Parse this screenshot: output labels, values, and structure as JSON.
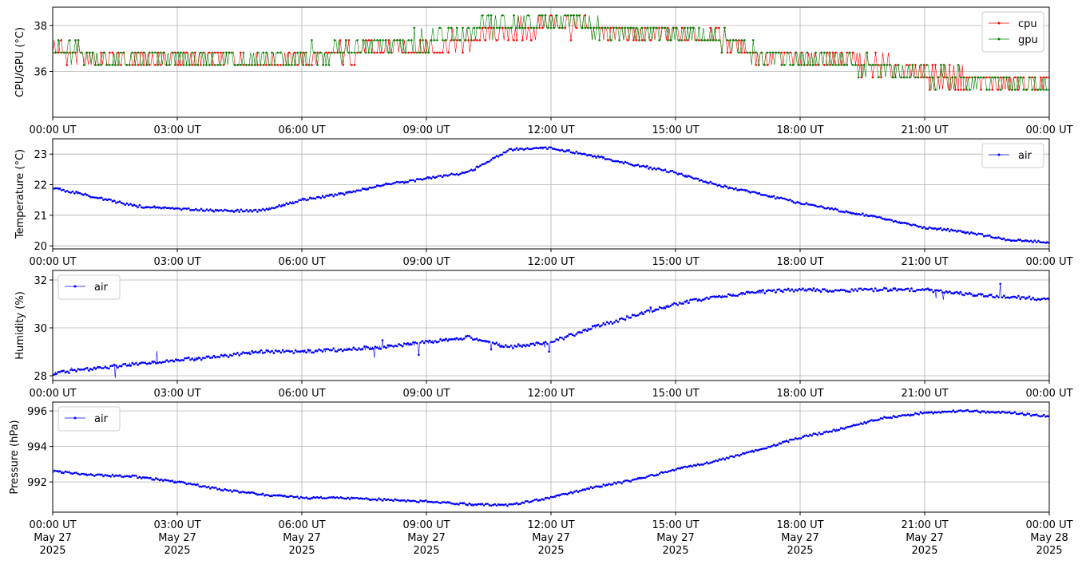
{
  "chart_data": [
    {
      "type": "line",
      "ylabel": "CPU/GPU (°C)",
      "ylim": [
        34.0,
        38.8
      ],
      "yticks": [
        36,
        38
      ],
      "ytick_labels": [
        "36",
        "38"
      ],
      "grid": true,
      "legend_position": "top-right",
      "x": [
        "00:00",
        "01:00",
        "02:00",
        "03:00",
        "04:00",
        "05:00",
        "06:00",
        "07:00",
        "08:00",
        "09:00",
        "10:00",
        "11:00",
        "12:00",
        "13:00",
        "14:00",
        "15:00",
        "16:00",
        "17:00",
        "18:00",
        "19:00",
        "20:00",
        "21:00",
        "22:00",
        "23:00",
        "24:00"
      ],
      "series": [
        {
          "name": "cpu",
          "color": "#ff0000",
          "values": [
            36.9,
            36.4,
            36.4,
            36.4,
            36.4,
            36.4,
            36.4,
            36.7,
            36.9,
            36.9,
            37.2,
            37.6,
            38.0,
            37.8,
            37.5,
            37.5,
            37.4,
            36.6,
            36.5,
            36.4,
            36.1,
            35.7,
            35.6,
            35.4,
            35.3
          ]
        },
        {
          "name": "gpu",
          "color": "#008000",
          "values": [
            36.9,
            36.5,
            36.4,
            36.4,
            36.4,
            36.4,
            36.5,
            36.8,
            37.0,
            37.2,
            37.5,
            38.0,
            38.1,
            37.9,
            37.6,
            37.5,
            37.4,
            36.6,
            36.5,
            36.4,
            36.0,
            35.6,
            35.5,
            35.4,
            35.3
          ]
        }
      ]
    },
    {
      "type": "line",
      "ylabel": "Temperature (°C)",
      "ylim": [
        19.9,
        23.5
      ],
      "yticks": [
        20,
        21,
        22,
        23
      ],
      "ytick_labels": [
        "20",
        "21",
        "22",
        "23"
      ],
      "grid": true,
      "legend_position": "top-right",
      "x": [
        "00:00",
        "01:00",
        "02:00",
        "03:00",
        "04:00",
        "05:00",
        "06:00",
        "07:00",
        "08:00",
        "09:00",
        "10:00",
        "11:00",
        "12:00",
        "13:00",
        "14:00",
        "15:00",
        "16:00",
        "17:00",
        "18:00",
        "19:00",
        "20:00",
        "21:00",
        "22:00",
        "23:00",
        "24:00"
      ],
      "series": [
        {
          "name": "air",
          "color": "#0000ff",
          "values": [
            21.9,
            21.6,
            21.3,
            21.2,
            21.15,
            21.15,
            21.5,
            21.7,
            22.0,
            22.2,
            22.4,
            23.15,
            23.2,
            22.95,
            22.65,
            22.4,
            22.0,
            21.7,
            21.4,
            21.15,
            20.9,
            20.6,
            20.45,
            20.2,
            20.1
          ]
        }
      ]
    },
    {
      "type": "line",
      "ylabel": "Humidity (%)",
      "ylim": [
        27.8,
        32.4
      ],
      "yticks": [
        28,
        30,
        32
      ],
      "ytick_labels": [
        "28",
        "30",
        "32"
      ],
      "grid": true,
      "legend_position": "top-left",
      "x": [
        "00:00",
        "01:00",
        "02:00",
        "03:00",
        "04:00",
        "05:00",
        "06:00",
        "07:00",
        "08:00",
        "09:00",
        "10:00",
        "11:00",
        "12:00",
        "13:00",
        "14:00",
        "15:00",
        "16:00",
        "17:00",
        "18:00",
        "19:00",
        "20:00",
        "21:00",
        "22:00",
        "23:00",
        "24:00"
      ],
      "series": [
        {
          "name": "air",
          "color": "#0000ff",
          "values": [
            28.1,
            28.3,
            28.5,
            28.65,
            28.8,
            29.0,
            29.0,
            29.1,
            29.2,
            29.4,
            29.6,
            29.2,
            29.4,
            30.0,
            30.5,
            31.0,
            31.3,
            31.5,
            31.6,
            31.55,
            31.6,
            31.6,
            31.4,
            31.3,
            31.2
          ]
        }
      ]
    },
    {
      "type": "line",
      "ylabel": "Pressure (hPa)",
      "ylim": [
        990.3,
        996.5
      ],
      "yticks": [
        992,
        994,
        996
      ],
      "ytick_labels": [
        "992",
        "994",
        "996"
      ],
      "grid": true,
      "legend_position": "top-left",
      "x": [
        "00:00",
        "01:00",
        "02:00",
        "03:00",
        "04:00",
        "05:00",
        "06:00",
        "07:00",
        "08:00",
        "09:00",
        "10:00",
        "11:00",
        "12:00",
        "13:00",
        "14:00",
        "15:00",
        "16:00",
        "17:00",
        "18:00",
        "19:00",
        "20:00",
        "21:00",
        "22:00",
        "23:00",
        "24:00"
      ],
      "xtick_labels": [
        "00:00 UT\nMay 27\n2025",
        "03:00 UT\nMay 27\n2025",
        "06:00 UT\nMay 27\n2025",
        "09:00 UT\nMay 27\n2025",
        "12:00 UT\nMay 27\n2025",
        "15:00 UT\nMay 27\n2025",
        "18:00 UT\nMay 27\n2025",
        "21:00 UT\nMay 27\n2025",
        "00:00 UT\nMay 28\n2025"
      ],
      "series": [
        {
          "name": "air",
          "color": "#0000ff",
          "values": [
            992.6,
            992.4,
            992.3,
            992.0,
            991.6,
            991.3,
            991.1,
            991.1,
            991.0,
            990.9,
            990.75,
            990.7,
            991.1,
            991.7,
            992.1,
            992.7,
            993.2,
            993.8,
            994.5,
            995.0,
            995.6,
            995.9,
            996.0,
            995.9,
            995.7
          ]
        }
      ]
    }
  ],
  "xaxis": {
    "tick_labels": [
      "00:00 UT",
      "03:00 UT",
      "06:00 UT",
      "09:00 UT",
      "12:00 UT",
      "15:00 UT",
      "18:00 UT",
      "21:00 UT",
      "00:00 UT"
    ]
  }
}
